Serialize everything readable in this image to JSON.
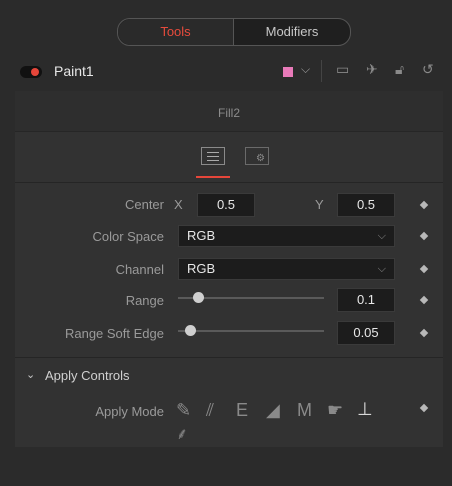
{
  "tabs": {
    "tools": "Tools",
    "modifiers": "Modifiers"
  },
  "node": {
    "name": "Paint1",
    "color": "#e87ab9"
  },
  "stroke": {
    "name": "Fill2"
  },
  "controls": {
    "center": {
      "label": "Center",
      "x_label": "X",
      "x_value": "0.5",
      "y_label": "Y",
      "y_value": "0.5"
    },
    "color_space": {
      "label": "Color Space",
      "value": "RGB"
    },
    "channel": {
      "label": "Channel",
      "value": "RGB"
    },
    "range": {
      "label": "Range",
      "value": "0.1",
      "level": 0.1
    },
    "range_soft_edge": {
      "label": "Range Soft Edge",
      "value": "0.05",
      "level": 0.05
    }
  },
  "apply_controls": {
    "label": "Apply Controls",
    "mode_label": "Apply Mode",
    "icons": [
      "color-brush-icon",
      "clone-brush-icon",
      "emboss-icon",
      "erase-icon",
      "merge-icon",
      "smear-icon",
      "stamp-icon",
      "wire-icon"
    ]
  },
  "icons": [
    "chevron-down-icon",
    "duplicate-icon",
    "pin-icon",
    "lock-icon",
    "reset-icon",
    "keyframe-diamond-icon"
  ]
}
